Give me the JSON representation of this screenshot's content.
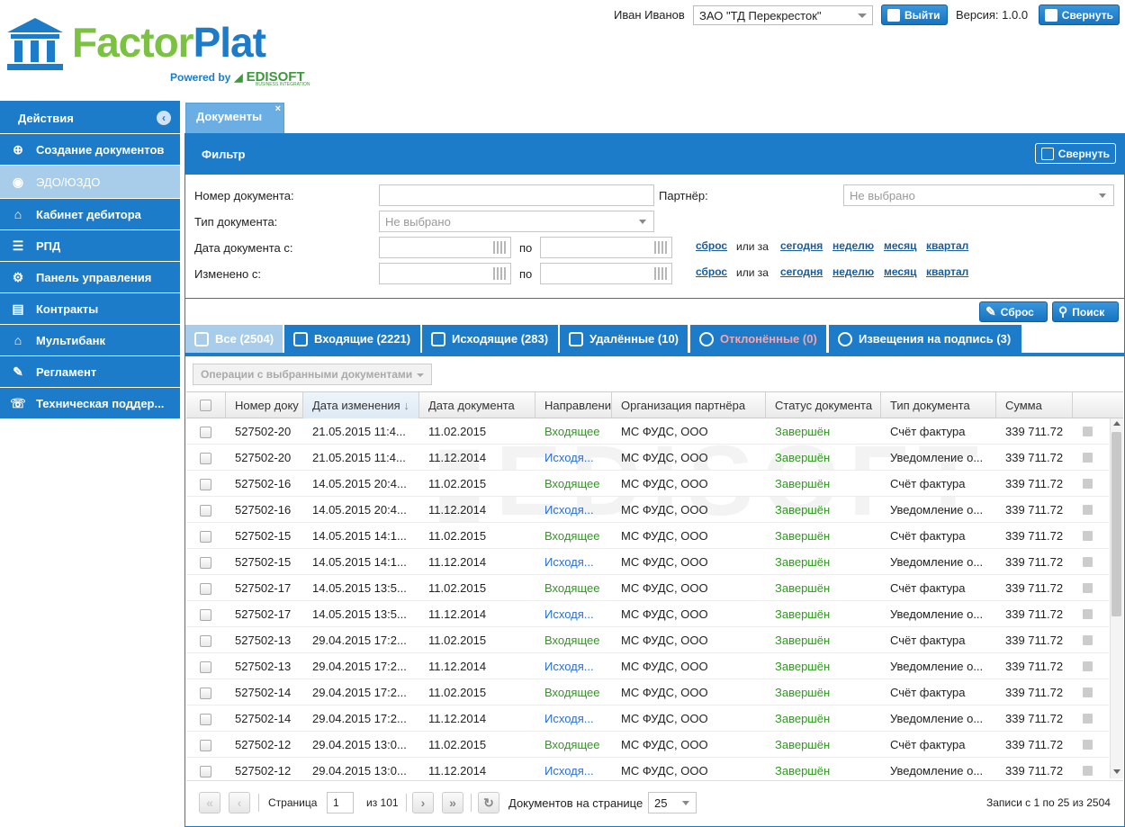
{
  "app": {
    "logo_part1": "Factor",
    "logo_part2": "Plat",
    "powered_by": "Powered by",
    "partner": "EDISOFT",
    "partner_sub": "BUSINESS INTEGRATION"
  },
  "header": {
    "user": "Иван Иванов",
    "company": "ЗАО \"ТД Перекресток\"",
    "logout": "Выйти",
    "version": "Версия: 1.0.0",
    "collapse": "Свернуть"
  },
  "sidebar": {
    "title": "Действия",
    "items": [
      {
        "label": "Создание документов",
        "icon": "doc-plus-icon"
      },
      {
        "label": "ЭДО/ЮЗДО",
        "icon": "eye-icon"
      },
      {
        "label": "Кабинет дебитора",
        "icon": "bank-icon"
      },
      {
        "label": "РПД",
        "icon": "list-icon"
      },
      {
        "label": "Панель управления",
        "icon": "gear-icon"
      },
      {
        "label": "Контракты",
        "icon": "contract-icon"
      },
      {
        "label": "Мультибанк",
        "icon": "bank-icon"
      },
      {
        "label": "Регламент",
        "icon": "reglament-icon"
      },
      {
        "label": "Техническая поддер...",
        "icon": "phone-icon"
      }
    ]
  },
  "tab": {
    "label": "Документы",
    "close": "×"
  },
  "filter": {
    "title": "Фильтр",
    "collapse": "Свернуть",
    "doc_number": "Номер документа:",
    "partner": "Партнёр:",
    "partner_placeholder": "Не выбрано",
    "doc_type": "Тип документа:",
    "doc_type_placeholder": "Не выбрано",
    "doc_date_from": "Дата документа с:",
    "changed_from": "Изменено с:",
    "to": "по",
    "reset_link": "сброс",
    "or_for": "или за",
    "today": "сегодня",
    "week": "неделю",
    "month": "месяц",
    "quarter": "квартал",
    "reset_btn": "Сброс",
    "search_btn": "Поиск"
  },
  "doc_tabs": [
    "Все (2504)",
    "Входящие (2221)",
    "Исходящие (283)",
    "Удалённые (10)",
    "Отклонённые (0)",
    "Извещения на подпись (3)"
  ],
  "operations": "Операции с выбранными документами",
  "columns": [
    "Номер доку",
    "Дата изменения",
    "Дата документа",
    "Направлени",
    "Организация партнёра",
    "Статус документа",
    "Тип документа",
    "Сумма"
  ],
  "rows": [
    [
      "527502-20",
      "21.05.2015 11:4...",
      "11.02.2015",
      "Входящее",
      "МС ФУДС, ООО",
      "Завершён",
      "Счёт фактура",
      "339 711.72"
    ],
    [
      "527502-20",
      "21.05.2015 11:4...",
      "11.12.2014",
      "Исходя...",
      "МС ФУДС, ООО",
      "Завершён",
      "Уведомление о...",
      "339 711.72"
    ],
    [
      "527502-16",
      "14.05.2015 20:4...",
      "11.02.2015",
      "Входящее",
      "МС ФУДС, ООО",
      "Завершён",
      "Счёт фактура",
      "339 711.72"
    ],
    [
      "527502-16",
      "14.05.2015 20:4...",
      "11.12.2014",
      "Исходя...",
      "МС ФУДС, ООО",
      "Завершён",
      "Уведомление о...",
      "339 711.72"
    ],
    [
      "527502-15",
      "14.05.2015 14:1...",
      "11.02.2015",
      "Входящее",
      "МС ФУДС, ООО",
      "Завершён",
      "Счёт фактура",
      "339 711.72"
    ],
    [
      "527502-15",
      "14.05.2015 14:1...",
      "11.12.2014",
      "Исходя...",
      "МС ФУДС, ООО",
      "Завершён",
      "Уведомление о...",
      "339 711.72"
    ],
    [
      "527502-17",
      "14.05.2015 13:5...",
      "11.02.2015",
      "Входящее",
      "МС ФУДС, ООО",
      "Завершён",
      "Счёт фактура",
      "339 711.72"
    ],
    [
      "527502-17",
      "14.05.2015 13:5...",
      "11.12.2014",
      "Исходя...",
      "МС ФУДС, ООО",
      "Завершён",
      "Уведомление о...",
      "339 711.72"
    ],
    [
      "527502-13",
      "29.04.2015 17:2...",
      "11.02.2015",
      "Входящее",
      "МС ФУДС, ООО",
      "Завершён",
      "Счёт фактура",
      "339 711.72"
    ],
    [
      "527502-13",
      "29.04.2015 17:2...",
      "11.12.2014",
      "Исходя...",
      "МС ФУДС, ООО",
      "Завершён",
      "Уведомление о...",
      "339 711.72"
    ],
    [
      "527502-14",
      "29.04.2015 17:2...",
      "11.02.2015",
      "Входящее",
      "МС ФУДС, ООО",
      "Завершён",
      "Счёт фактура",
      "339 711.72"
    ],
    [
      "527502-14",
      "29.04.2015 17:2...",
      "11.12.2014",
      "Исходя...",
      "МС ФУДС, ООО",
      "Завершён",
      "Уведомление о...",
      "339 711.72"
    ],
    [
      "527502-12",
      "29.04.2015 13:0...",
      "11.02.2015",
      "Входящее",
      "МС ФУДС, ООО",
      "Завершён",
      "Счёт фактура",
      "339 711.72"
    ],
    [
      "527502-12",
      "29.04.2015 13:0...",
      "11.12.2014",
      "Исходя...",
      "МС ФУДС, ООО",
      "Завершён",
      "Уведомление о...",
      "339 711.72"
    ]
  ],
  "pager": {
    "page_label": "Страница",
    "page": "1",
    "of": "из 101",
    "per_page_label": "Документов на странице",
    "per_page": "25",
    "summary": "Записи с 1 по 25 из 2504"
  },
  "colors": {
    "primary": "#1c7cc9",
    "active": "#a7cdea",
    "incoming": "#2e9a1e",
    "outgoing": "#2a6fd0",
    "rejected": "#f9a3a8"
  }
}
